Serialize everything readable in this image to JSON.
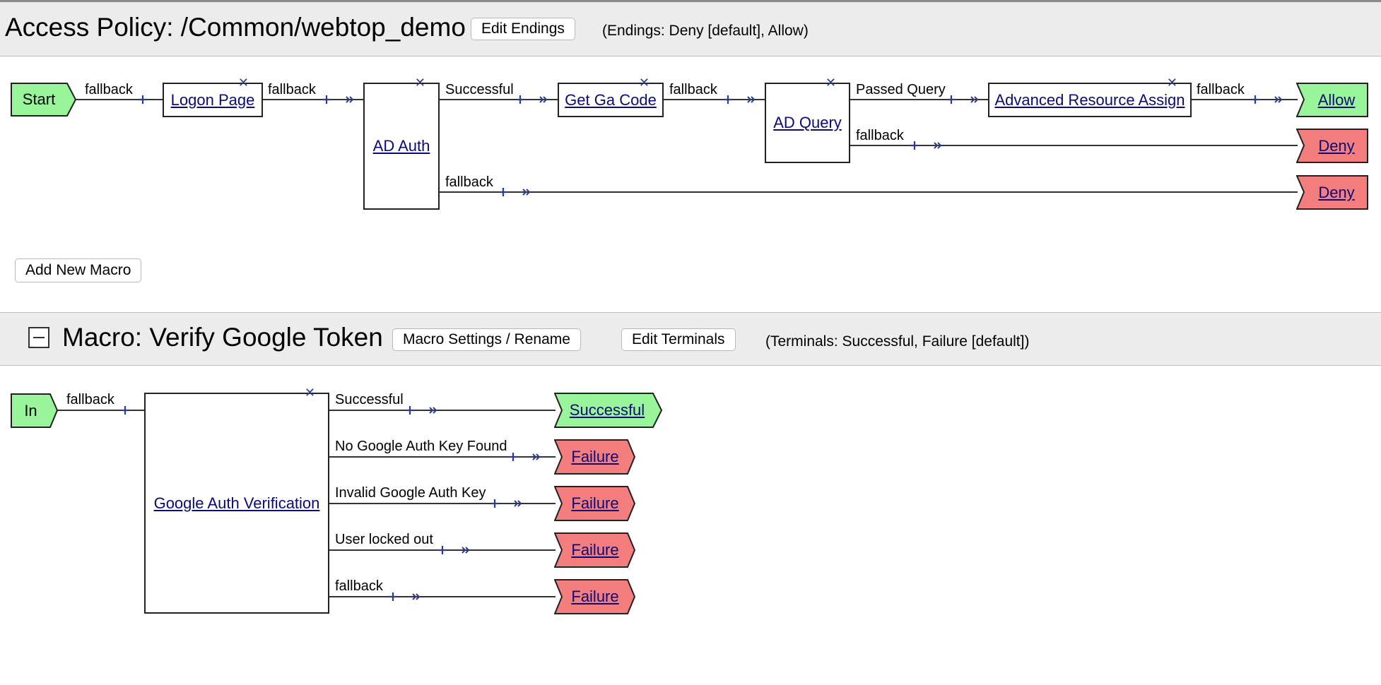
{
  "policy": {
    "title": "Access Policy: /Common/webtop_demo",
    "edit_endings_label": "Edit Endings",
    "endings_note": "(Endings: Deny [default], Allow)",
    "start_label": "Start",
    "nodes": {
      "logon_page": "Logon Page",
      "ad_auth": "AD Auth",
      "get_ga_code": "Get Ga Code",
      "ad_query": "AD Query",
      "adv_resource": "Advanced Resource Assign"
    },
    "branches": {
      "start_fallback": "fallback",
      "logon_fallback": "fallback",
      "adauth_successful": "Successful",
      "adauth_fallback": "fallback",
      "getga_fallback": "fallback",
      "adquery_passed": "Passed Query",
      "adquery_fallback": "fallback",
      "adv_fallback": "fallback"
    },
    "endings": {
      "allow": "Allow",
      "deny_1": "Deny",
      "deny_2": "Deny"
    },
    "add_macro_label": "Add New Macro"
  },
  "macro": {
    "title": "Macro: Verify Google Token",
    "settings_label": "Macro Settings / Rename",
    "edit_terminals_label": "Edit Terminals",
    "terminals_note": "(Terminals: Successful, Failure [default])",
    "in_label": "In",
    "in_fallback": "fallback",
    "node": "Google Auth Verification",
    "branches": [
      "Successful",
      "No Google Auth Key Found",
      "Invalid Google Auth Key",
      "User locked out",
      "fallback"
    ],
    "terminals": [
      "Successful",
      "Failure",
      "Failure",
      "Failure",
      "Failure"
    ]
  },
  "colors": {
    "green": "#99f599",
    "red": "#f47e7e",
    "wire": "#333333",
    "plus": "#2a3b8f"
  },
  "icons": [
    "close-icon",
    "plus-icon",
    "arrow-icon",
    "collapse-icon"
  ]
}
